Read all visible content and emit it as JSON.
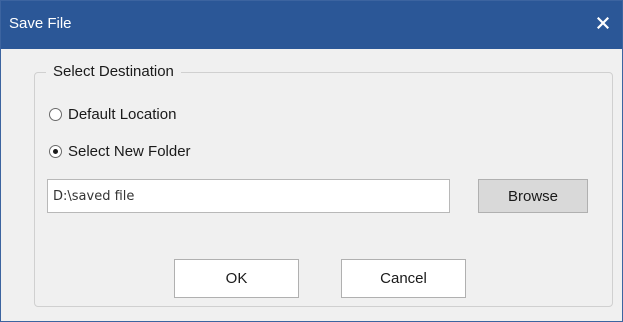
{
  "window": {
    "title": "Save File",
    "close_icon": "close-icon",
    "accent_color": "#2b5797"
  },
  "destination_group": {
    "legend": "Select Destination",
    "options": [
      {
        "label": "Default Location",
        "selected": false
      },
      {
        "label": "Select New Folder",
        "selected": true
      }
    ],
    "path_value": "D:\\saved file",
    "browse_label": "Browse"
  },
  "buttons": {
    "ok_label": "OK",
    "cancel_label": "Cancel"
  }
}
